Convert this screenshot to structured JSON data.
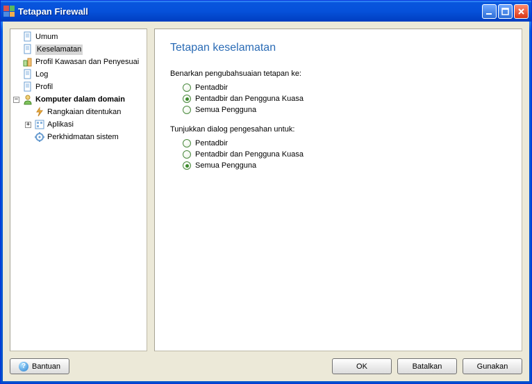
{
  "window": {
    "title": "Tetapan Firewall"
  },
  "sidebar": {
    "items": [
      {
        "label": "Umum"
      },
      {
        "label": "Keselamatan"
      },
      {
        "label": "Profil Kawasan dan Penyesuai"
      },
      {
        "label": "Log"
      },
      {
        "label": "Profil"
      },
      {
        "label": "Komputer dalam domain"
      },
      {
        "label": "Rangkaian ditentukan"
      },
      {
        "label": "Aplikasi"
      },
      {
        "label": "Perkhidmatan sistem"
      }
    ]
  },
  "content": {
    "heading": "Tetapan keselamatan",
    "section1": {
      "label": "Benarkan pengubahsuaian tetapan ke:",
      "options": [
        {
          "label": "Pentadbir"
        },
        {
          "label": "Pentadbir dan Pengguna Kuasa"
        },
        {
          "label": "Semua Pengguna"
        }
      ]
    },
    "section2": {
      "label": "Tunjukkan dialog pengesahan untuk:",
      "options": [
        {
          "label": "Pentadbir"
        },
        {
          "label": "Pentadbir dan Pengguna Kuasa"
        },
        {
          "label": "Semua Pengguna"
        }
      ]
    }
  },
  "buttons": {
    "help": "Bantuan",
    "ok": "OK",
    "cancel": "Batalkan",
    "apply": "Gunakan"
  }
}
